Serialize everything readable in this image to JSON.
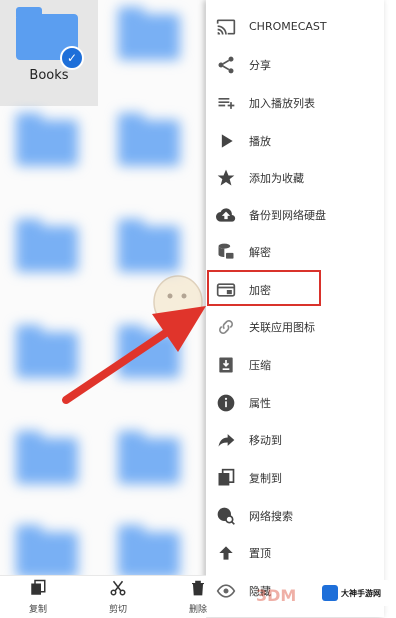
{
  "folder": {
    "name": "Books",
    "selected": true
  },
  "menu": {
    "items": [
      {
        "label": "CHROMECAST",
        "icon": "cast-icon"
      },
      {
        "label": "分享",
        "icon": "share-icon"
      },
      {
        "label": "加入播放列表",
        "icon": "playlist-add-icon"
      },
      {
        "label": "播放",
        "icon": "play-icon"
      },
      {
        "label": "添加为收藏",
        "icon": "star-icon"
      },
      {
        "label": "备份到网络硬盘",
        "icon": "cloud-upload-icon"
      },
      {
        "label": "解密",
        "icon": "decrypt-icon"
      },
      {
        "label": "加密",
        "icon": "encrypt-icon"
      },
      {
        "label": "关联应用图标",
        "icon": "link-icon"
      },
      {
        "label": "压缩",
        "icon": "compress-icon"
      },
      {
        "label": "属性",
        "icon": "info-icon"
      },
      {
        "label": "移动到",
        "icon": "move-icon"
      },
      {
        "label": "复制到",
        "icon": "copy-to-icon"
      },
      {
        "label": "网络搜索",
        "icon": "web-search-icon"
      },
      {
        "label": "置顶",
        "icon": "pin-top-icon"
      },
      {
        "label": "隐藏",
        "icon": "hide-icon"
      }
    ],
    "highlighted_item": "加密"
  },
  "bottom_bar": {
    "items": [
      {
        "label": "复制",
        "icon": "copy-icon"
      },
      {
        "label": "剪切",
        "icon": "cut-icon"
      },
      {
        "label": "删除",
        "icon": "delete-icon"
      }
    ]
  },
  "watermark": {
    "logo_text": "3DM",
    "site_text": "大神手游网"
  },
  "colors": {
    "accent": "#1e6fd9",
    "folder": "#5b9ef0",
    "highlight": "#d9322b"
  }
}
